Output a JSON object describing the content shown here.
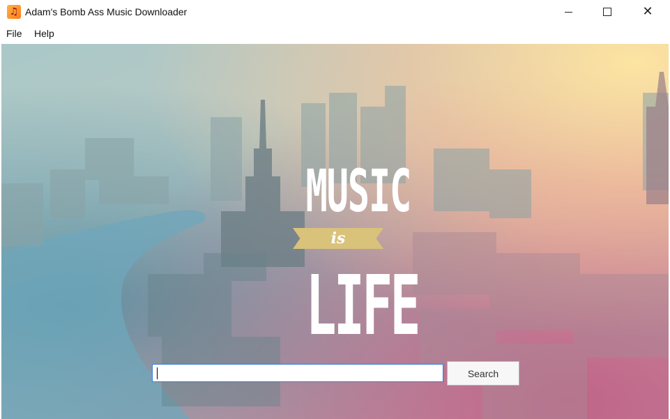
{
  "window": {
    "title": "Adam's Bomb Ass Music Downloader",
    "icon": "music-note-icon",
    "controls": [
      "minimize-icon",
      "maximize-icon",
      "close-icon"
    ]
  },
  "menu": {
    "items": [
      {
        "label": "File"
      },
      {
        "label": "Help"
      }
    ]
  },
  "banner": {
    "line1": "MUSIC",
    "line2": "is",
    "line3": "LIFE"
  },
  "search": {
    "value": "",
    "button_label": "Search"
  },
  "colors": {
    "input_border": "#3d7bd6",
    "logo_ribbon": "#d9c27a"
  }
}
